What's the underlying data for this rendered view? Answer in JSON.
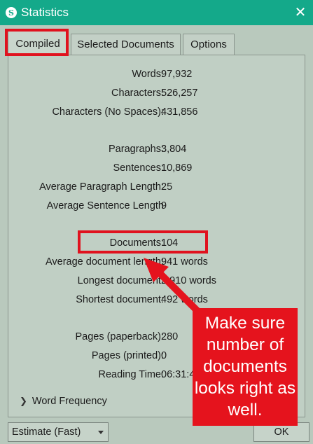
{
  "window": {
    "title": "Statistics",
    "app_icon": "S",
    "close_glyph": "✕",
    "close_icon": "close-icon"
  },
  "tabs": [
    {
      "label": "Compiled",
      "active": true
    },
    {
      "label": "Selected Documents",
      "active": false
    },
    {
      "label": "Options",
      "active": false
    }
  ],
  "stats": [
    {
      "label": "Words:",
      "value": "97,932"
    },
    {
      "label": "Characters:",
      "value": "526,257"
    },
    {
      "label": "Characters (No Spaces):",
      "value": "431,856"
    },
    {
      "label": "Paragraphs:",
      "value": "3,804"
    },
    {
      "label": "Sentences:",
      "value": "10,869"
    },
    {
      "label": "Average Paragraph Length:",
      "value": "25"
    },
    {
      "label": "Average Sentence Length",
      "value": "9"
    },
    {
      "label": "Documents:",
      "value": "104"
    },
    {
      "label": "Average document length:",
      "value": "941 words"
    },
    {
      "label": "Longest document:",
      "value": "2,910 words"
    },
    {
      "label": "Shortest document:",
      "value": "492 words"
    },
    {
      "label": "Pages (paperback):",
      "value": "280"
    },
    {
      "label": "Pages (printed):",
      "value": "0"
    },
    {
      "label": "Reading Time:",
      "value": "06:31:4"
    }
  ],
  "word_frequency": {
    "label": "Word Frequency",
    "icon": "chevron-right-icon"
  },
  "footer": {
    "dropdown_value": "Estimate (Fast)",
    "ok_label": "OK"
  },
  "annotation": {
    "callout_text": "Make sure number of documents looks right as well.",
    "highlight_color": "#e0121e"
  },
  "colors": {
    "titlebar": "#14a98a",
    "background": "#b9c9bd",
    "annotation_red": "#e5131d"
  }
}
